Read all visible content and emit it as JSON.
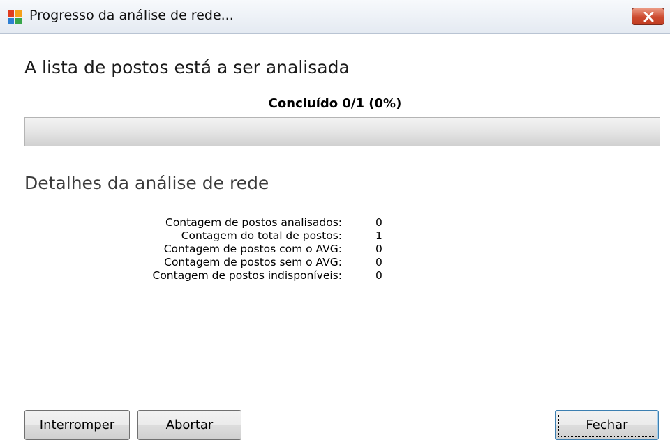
{
  "window": {
    "title": "Progresso da análise de rede...",
    "icon": "avg-logo-icon",
    "close_icon": "close-icon"
  },
  "main": {
    "heading": "A lista de postos está a ser analisada",
    "progress": {
      "label": "Concluído 0/1 (0%)",
      "completed": 0,
      "total": 1,
      "percent": 0
    }
  },
  "details": {
    "heading": "Detalhes da análise de rede",
    "rows": [
      {
        "label": "Contagem de postos analisados:",
        "value": "0"
      },
      {
        "label": "Contagem do total de postos:",
        "value": "1"
      },
      {
        "label": "Contagem de postos com o AVG:",
        "value": "0"
      },
      {
        "label": "Contagem de postos sem o AVG:",
        "value": "0"
      },
      {
        "label": "Contagem de postos indisponíveis:",
        "value": "0"
      }
    ]
  },
  "buttons": {
    "interrupt": "Interromper",
    "abort": "Abortar",
    "close": "Fechar"
  },
  "colors": {
    "close_button": "#c94a2f",
    "progress_fill": "#5fb33c"
  }
}
